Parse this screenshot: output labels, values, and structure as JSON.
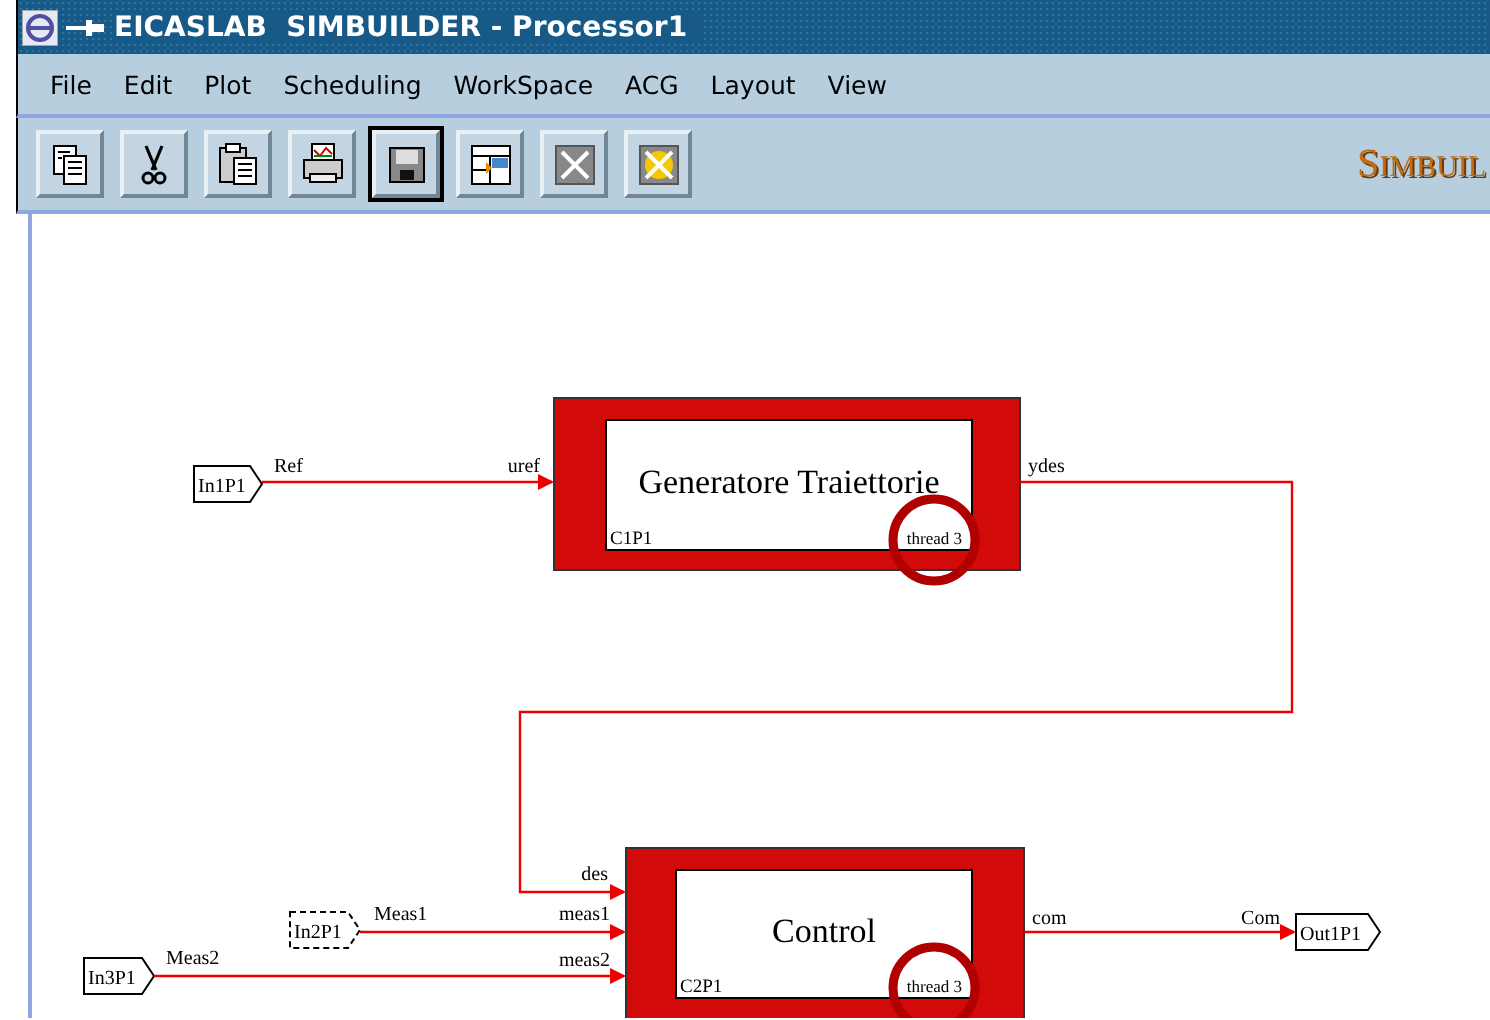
{
  "window": {
    "title": "EICASLAB  SIMBUILDER - Processor1"
  },
  "menu": [
    {
      "label": "File"
    },
    {
      "label": "Edit"
    },
    {
      "label": "Plot"
    },
    {
      "label": "Scheduling"
    },
    {
      "label": "WorkSpace"
    },
    {
      "label": "ACG"
    },
    {
      "label": "Layout"
    },
    {
      "label": "View"
    }
  ],
  "toolbar": [
    {
      "kind": "copy",
      "selected": false
    },
    {
      "kind": "cut",
      "selected": false
    },
    {
      "kind": "paste",
      "selected": false
    },
    {
      "kind": "print",
      "selected": false
    },
    {
      "kind": "save",
      "selected": true
    },
    {
      "kind": "layout",
      "selected": false
    },
    {
      "kind": "close",
      "selected": false
    },
    {
      "kind": "close-all",
      "selected": false
    }
  ],
  "logo": "SIMBUIL",
  "diagram": {
    "blocks": [
      {
        "title": "Generatore Traiettorie",
        "id": "C1P1",
        "thread": "thread 3",
        "highlighted": true
      },
      {
        "title": "Control",
        "id": "C2P1",
        "thread": "thread 3",
        "highlighted": true
      }
    ],
    "ports": [
      {
        "label": "In1P1",
        "dashed": false
      },
      {
        "label": "In2P1",
        "dashed": true
      },
      {
        "label": "In3P1",
        "dashed": false
      },
      {
        "label": "Out1P1",
        "dashed": false
      }
    ],
    "signals": [
      {
        "from_label": "Ref",
        "to_label": "uref"
      },
      {
        "from_label": "ydes",
        "to_label": "des"
      },
      {
        "from_label": "Meas1",
        "to_label": "meas1"
      },
      {
        "from_label": "Meas2",
        "to_label": "meas2"
      },
      {
        "from_label": "com",
        "to_label": "Com"
      }
    ]
  }
}
